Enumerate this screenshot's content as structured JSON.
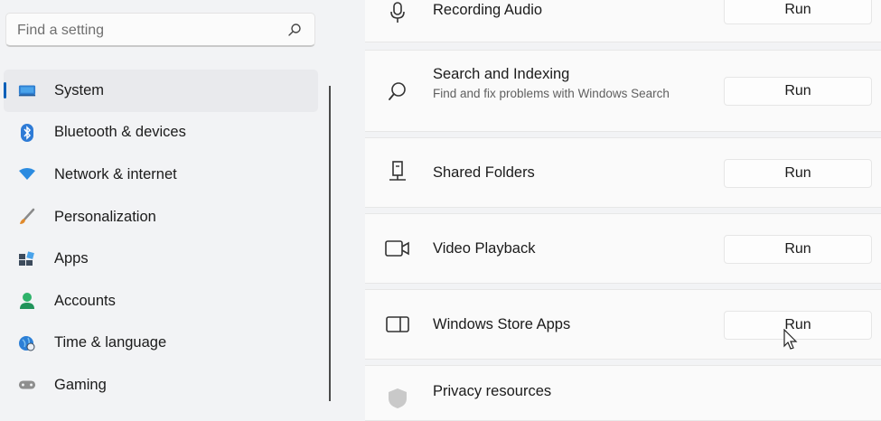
{
  "search": {
    "placeholder": "Find a setting",
    "icon": "search-icon"
  },
  "sidebar": {
    "items": [
      {
        "label": "System",
        "icon": "system-monitor-icon",
        "active": true
      },
      {
        "label": "Bluetooth & devices",
        "icon": "bluetooth-icon"
      },
      {
        "label": "Network & internet",
        "icon": "wifi-icon"
      },
      {
        "label": "Personalization",
        "icon": "paintbrush-icon"
      },
      {
        "label": "Apps",
        "icon": "apps-icon"
      },
      {
        "label": "Accounts",
        "icon": "person-icon"
      },
      {
        "label": "Time & language",
        "icon": "globe-clock-icon"
      },
      {
        "label": "Gaming",
        "icon": "gamepad-icon"
      }
    ]
  },
  "troubleshooters": [
    {
      "title": "Recording Audio",
      "description": "",
      "icon": "microphone-icon",
      "button": "Run"
    },
    {
      "title": "Search and Indexing",
      "description": "Find and fix problems with Windows Search",
      "icon": "search-icon",
      "button": "Run"
    },
    {
      "title": "Shared Folders",
      "description": "",
      "icon": "shared-folder-icon",
      "button": "Run"
    },
    {
      "title": "Video Playback",
      "description": "",
      "icon": "video-camera-icon",
      "button": "Run"
    },
    {
      "title": "Windows Store Apps",
      "description": "",
      "icon": "store-app-icon",
      "button": "Run"
    }
  ],
  "privacy": {
    "title": "Privacy resources",
    "icon": "shield-icon"
  },
  "colors": {
    "accent": "#005fb8",
    "background": "#f2f3f5",
    "card": "#fafafa"
  }
}
